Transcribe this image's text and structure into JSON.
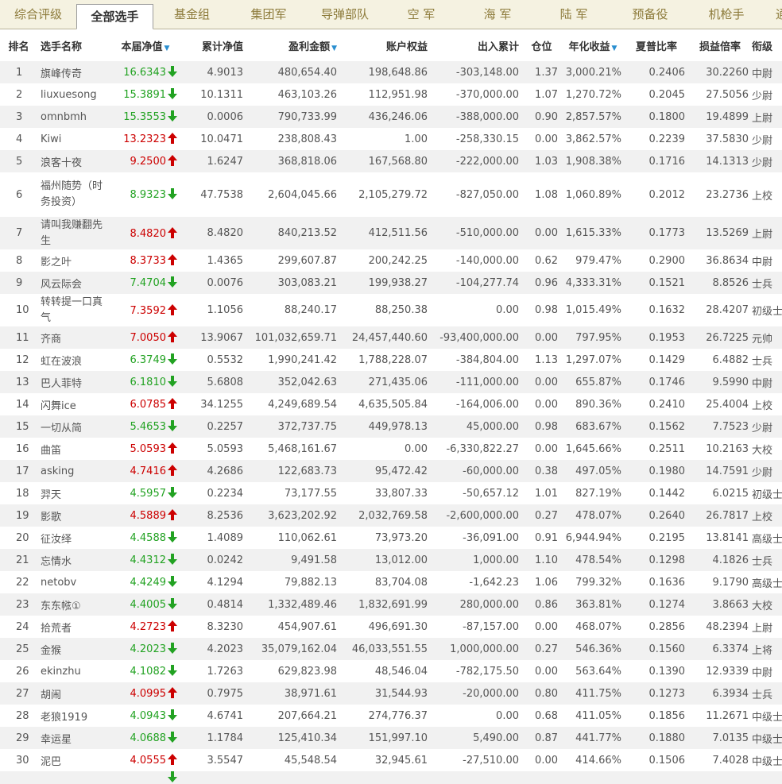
{
  "tabs": [
    {
      "label": "综合评级"
    },
    {
      "label": "全部选手"
    },
    {
      "label": "基金组"
    },
    {
      "label": "集团军"
    },
    {
      "label": "导弹部队"
    },
    {
      "label": "空 军"
    },
    {
      "label": "海 军"
    },
    {
      "label": "陆 军"
    },
    {
      "label": "预备役"
    },
    {
      "label": "机枪手"
    },
    {
      "label": "通"
    }
  ],
  "active_tab": 1,
  "columns": {
    "rank": "排名",
    "name": "选手名称",
    "nav": "本届净值",
    "cum_nav": "累计净值",
    "profit": "盈利金额",
    "equity": "账户权益",
    "flow": "出入累计",
    "position": "仓位",
    "annual": "年化收益",
    "sharpe": "夏普比率",
    "pl_ratio": "损益倍率",
    "title": "衔级"
  },
  "colors": {
    "up": "#cc0000",
    "down": "#22a222",
    "sort": "#2a8fd0"
  },
  "rows": [
    {
      "rank": "1",
      "name": "旗峰传奇",
      "nav": "16.6343",
      "dir": "down",
      "cum_nav": "4.9013",
      "profit": "480,654.40",
      "equity": "198,648.86",
      "flow": "-303,148.00",
      "position": "1.37",
      "annual": "3,000.21%",
      "sharpe": "0.2406",
      "pl_ratio": "30.2260",
      "title": "中尉"
    },
    {
      "rank": "2",
      "name": "liuxuesong",
      "nav": "15.3891",
      "dir": "down",
      "cum_nav": "10.1311",
      "profit": "463,103.26",
      "equity": "112,951.98",
      "flow": "-370,000.00",
      "position": "1.07",
      "annual": "1,270.72%",
      "sharpe": "0.2045",
      "pl_ratio": "27.5056",
      "title": "少尉"
    },
    {
      "rank": "3",
      "name": "omnbmh",
      "nav": "15.3553",
      "dir": "down",
      "cum_nav": "0.0006",
      "profit": "790,733.99",
      "equity": "436,246.06",
      "flow": "-388,000.00",
      "position": "0.90",
      "annual": "2,857.57%",
      "sharpe": "0.1800",
      "pl_ratio": "19.4899",
      "title": "上尉"
    },
    {
      "rank": "4",
      "name": "Kiwi",
      "nav": "13.2323",
      "dir": "up",
      "cum_nav": "10.0471",
      "profit": "238,808.43",
      "equity": "1.00",
      "flow": "-258,330.15",
      "position": "0.00",
      "annual": "3,862.57%",
      "sharpe": "0.2239",
      "pl_ratio": "37.5830",
      "title": "少尉"
    },
    {
      "rank": "5",
      "name": "浪客十夜",
      "nav": "9.2500",
      "dir": "up",
      "cum_nav": "1.6247",
      "profit": "368,818.06",
      "equity": "167,568.80",
      "flow": "-222,000.00",
      "position": "1.03",
      "annual": "1,908.38%",
      "sharpe": "0.1716",
      "pl_ratio": "14.1313",
      "title": "少尉"
    },
    {
      "rank": "6",
      "name": "福州随势（时务投资）",
      "nav": "8.9323",
      "dir": "down",
      "cum_nav": "47.7538",
      "profit": "2,604,045.66",
      "equity": "2,105,279.72",
      "flow": "-827,050.00",
      "position": "1.08",
      "annual": "1,060.89%",
      "sharpe": "0.2012",
      "pl_ratio": "23.2736",
      "title": "上校",
      "tall": 3
    },
    {
      "rank": "7",
      "name": "请叫我赚翻先生",
      "nav": "8.4820",
      "dir": "up",
      "cum_nav": "8.4820",
      "profit": "840,213.52",
      "equity": "412,511.56",
      "flow": "-510,000.00",
      "position": "0.00",
      "annual": "1,615.33%",
      "sharpe": "0.1773",
      "pl_ratio": "13.5269",
      "title": "上尉",
      "tall": 2
    },
    {
      "rank": "8",
      "name": "影之叶",
      "nav": "8.3733",
      "dir": "up",
      "cum_nav": "1.4365",
      "profit": "299,607.87",
      "equity": "200,242.25",
      "flow": "-140,000.00",
      "position": "0.62",
      "annual": "979.47%",
      "sharpe": "0.2900",
      "pl_ratio": "36.8634",
      "title": "中尉"
    },
    {
      "rank": "9",
      "name": "风云际会",
      "nav": "7.4704",
      "dir": "down",
      "cum_nav": "0.0076",
      "profit": "303,083.21",
      "equity": "199,938.27",
      "flow": "-104,277.74",
      "position": "0.96",
      "annual": "4,333.31%",
      "sharpe": "0.1521",
      "pl_ratio": "8.8526",
      "title": "士兵"
    },
    {
      "rank": "10",
      "name": "转转提一口真气",
      "nav": "7.3592",
      "dir": "up",
      "cum_nav": "1.1056",
      "profit": "88,240.17",
      "equity": "88,250.38",
      "flow": "0.00",
      "position": "0.98",
      "annual": "1,015.49%",
      "sharpe": "0.1632",
      "pl_ratio": "28.4207",
      "title": "初级士官",
      "tall": 2
    },
    {
      "rank": "11",
      "name": "齐商",
      "nav": "7.0050",
      "dir": "up",
      "cum_nav": "13.9067",
      "profit": "101,032,659.71",
      "equity": "24,457,440.60",
      "flow": "-93,400,000.00",
      "position": "0.00",
      "annual": "797.95%",
      "sharpe": "0.1953",
      "pl_ratio": "26.7225",
      "title": "元帅"
    },
    {
      "rank": "12",
      "name": "虹在波浪",
      "nav": "6.3749",
      "dir": "down",
      "cum_nav": "0.5532",
      "profit": "1,990,241.42",
      "equity": "1,788,228.07",
      "flow": "-384,804.00",
      "position": "1.13",
      "annual": "1,297.07%",
      "sharpe": "0.1429",
      "pl_ratio": "6.4882",
      "title": "士兵"
    },
    {
      "rank": "13",
      "name": "巴人菲特",
      "nav": "6.1810",
      "dir": "down",
      "cum_nav": "5.6808",
      "profit": "352,042.63",
      "equity": "271,435.06",
      "flow": "-111,000.00",
      "position": "0.00",
      "annual": "655.87%",
      "sharpe": "0.1746",
      "pl_ratio": "9.5990",
      "title": "中尉"
    },
    {
      "rank": "14",
      "name": "闪舞ice",
      "nav": "6.0785",
      "dir": "up",
      "cum_nav": "34.1255",
      "profit": "4,249,689.54",
      "equity": "4,635,505.84",
      "flow": "-164,006.00",
      "position": "0.00",
      "annual": "890.36%",
      "sharpe": "0.2410",
      "pl_ratio": "25.4004",
      "title": "上校"
    },
    {
      "rank": "15",
      "name": "一切从简",
      "nav": "5.4653",
      "dir": "down",
      "cum_nav": "0.2257",
      "profit": "372,737.75",
      "equity": "449,978.13",
      "flow": "45,000.00",
      "position": "0.98",
      "annual": "683.67%",
      "sharpe": "0.1562",
      "pl_ratio": "7.7523",
      "title": "少尉"
    },
    {
      "rank": "16",
      "name": "曲笛",
      "nav": "5.0593",
      "dir": "up",
      "cum_nav": "5.0593",
      "profit": "5,468,161.67",
      "equity": "0.00",
      "flow": "-6,330,822.27",
      "position": "0.00",
      "annual": "1,645.66%",
      "sharpe": "0.2511",
      "pl_ratio": "10.2163",
      "title": "大校"
    },
    {
      "rank": "17",
      "name": "asking",
      "nav": "4.7416",
      "dir": "up",
      "cum_nav": "4.2686",
      "profit": "122,683.73",
      "equity": "95,472.42",
      "flow": "-60,000.00",
      "position": "0.38",
      "annual": "497.05%",
      "sharpe": "0.1980",
      "pl_ratio": "14.7591",
      "title": "少尉"
    },
    {
      "rank": "18",
      "name": "羿天",
      "nav": "4.5957",
      "dir": "down",
      "cum_nav": "0.2234",
      "profit": "73,177.55",
      "equity": "33,807.33",
      "flow": "-50,657.12",
      "position": "1.01",
      "annual": "827.19%",
      "sharpe": "0.1442",
      "pl_ratio": "6.0215",
      "title": "初级士官"
    },
    {
      "rank": "19",
      "name": "影歌",
      "nav": "4.5889",
      "dir": "up",
      "cum_nav": "8.2536",
      "profit": "3,623,202.92",
      "equity": "2,032,769.58",
      "flow": "-2,600,000.00",
      "position": "0.27",
      "annual": "478.07%",
      "sharpe": "0.2640",
      "pl_ratio": "26.7817",
      "title": "上校"
    },
    {
      "rank": "20",
      "name": "征汝绎",
      "nav": "4.4588",
      "dir": "down",
      "cum_nav": "1.4089",
      "profit": "110,062.61",
      "equity": "73,973.20",
      "flow": "-36,091.00",
      "position": "0.91",
      "annual": "6,944.94%",
      "sharpe": "0.2195",
      "pl_ratio": "13.8141",
      "title": "高级士官"
    },
    {
      "rank": "21",
      "name": "忘情水",
      "nav": "4.4312",
      "dir": "down",
      "cum_nav": "0.0242",
      "profit": "9,491.58",
      "equity": "13,012.00",
      "flow": "1,000.00",
      "position": "1.10",
      "annual": "478.54%",
      "sharpe": "0.1298",
      "pl_ratio": "4.1826",
      "title": "士兵"
    },
    {
      "rank": "22",
      "name": "netobv",
      "nav": "4.4249",
      "dir": "down",
      "cum_nav": "4.1294",
      "profit": "79,882.13",
      "equity": "83,704.08",
      "flow": "-1,642.23",
      "position": "1.06",
      "annual": "799.32%",
      "sharpe": "0.1636",
      "pl_ratio": "9.1790",
      "title": "高级士官"
    },
    {
      "rank": "23",
      "name": "东东㡉①",
      "nav": "4.4005",
      "dir": "down",
      "cum_nav": "0.4814",
      "profit": "1,332,489.46",
      "equity": "1,832,691.99",
      "flow": "280,000.00",
      "position": "0.86",
      "annual": "363.81%",
      "sharpe": "0.1274",
      "pl_ratio": "3.8663",
      "title": "大校"
    },
    {
      "rank": "24",
      "name": "拾荒者",
      "nav": "4.2723",
      "dir": "up",
      "cum_nav": "8.3230",
      "profit": "454,907.61",
      "equity": "496,691.30",
      "flow": "-87,157.00",
      "position": "0.00",
      "annual": "468.07%",
      "sharpe": "0.2856",
      "pl_ratio": "48.2394",
      "title": "上尉"
    },
    {
      "rank": "25",
      "name": "金猴",
      "nav": "4.2023",
      "dir": "down",
      "cum_nav": "4.2023",
      "profit": "35,079,162.04",
      "equity": "46,033,551.55",
      "flow": "1,000,000.00",
      "position": "0.27",
      "annual": "546.36%",
      "sharpe": "0.1560",
      "pl_ratio": "6.3374",
      "title": "上将"
    },
    {
      "rank": "26",
      "name": "ekinzhu",
      "nav": "4.1082",
      "dir": "down",
      "cum_nav": "1.7263",
      "profit": "629,823.98",
      "equity": "48,546.04",
      "flow": "-782,175.50",
      "position": "0.00",
      "annual": "563.64%",
      "sharpe": "0.1390",
      "pl_ratio": "12.9339",
      "title": "中尉"
    },
    {
      "rank": "27",
      "name": "胡闹",
      "nav": "4.0995",
      "dir": "up",
      "cum_nav": "0.7975",
      "profit": "38,971.61",
      "equity": "31,544.93",
      "flow": "-20,000.00",
      "position": "0.80",
      "annual": "411.75%",
      "sharpe": "0.1273",
      "pl_ratio": "6.3934",
      "title": "士兵"
    },
    {
      "rank": "28",
      "name": "老狼1919",
      "nav": "4.0943",
      "dir": "down",
      "cum_nav": "4.6741",
      "profit": "207,664.21",
      "equity": "274,776.37",
      "flow": "0.00",
      "position": "0.68",
      "annual": "411.05%",
      "sharpe": "0.1856",
      "pl_ratio": "11.2671",
      "title": "中级士官"
    },
    {
      "rank": "29",
      "name": "幸运星",
      "nav": "4.0688",
      "dir": "down",
      "cum_nav": "1.1784",
      "profit": "125,410.34",
      "equity": "151,997.10",
      "flow": "5,490.00",
      "position": "0.87",
      "annual": "441.77%",
      "sharpe": "0.1880",
      "pl_ratio": "7.0135",
      "title": "中级士官"
    },
    {
      "rank": "30",
      "name": "泥巴",
      "nav": "4.0555",
      "dir": "up",
      "cum_nav": "3.5547",
      "profit": "45,548.54",
      "equity": "32,945.61",
      "flow": "-27,510.00",
      "position": "0.00",
      "annual": "414.66%",
      "sharpe": "0.1506",
      "pl_ratio": "7.4028",
      "title": "中级士官"
    },
    {
      "rank": "",
      "name": "",
      "nav": "",
      "dir": "down",
      "cum_nav": "",
      "profit": "",
      "equity": "",
      "flow": "",
      "position": "",
      "annual": "",
      "sharpe": "",
      "pl_ratio": "",
      "title": "",
      "partial": true
    }
  ]
}
